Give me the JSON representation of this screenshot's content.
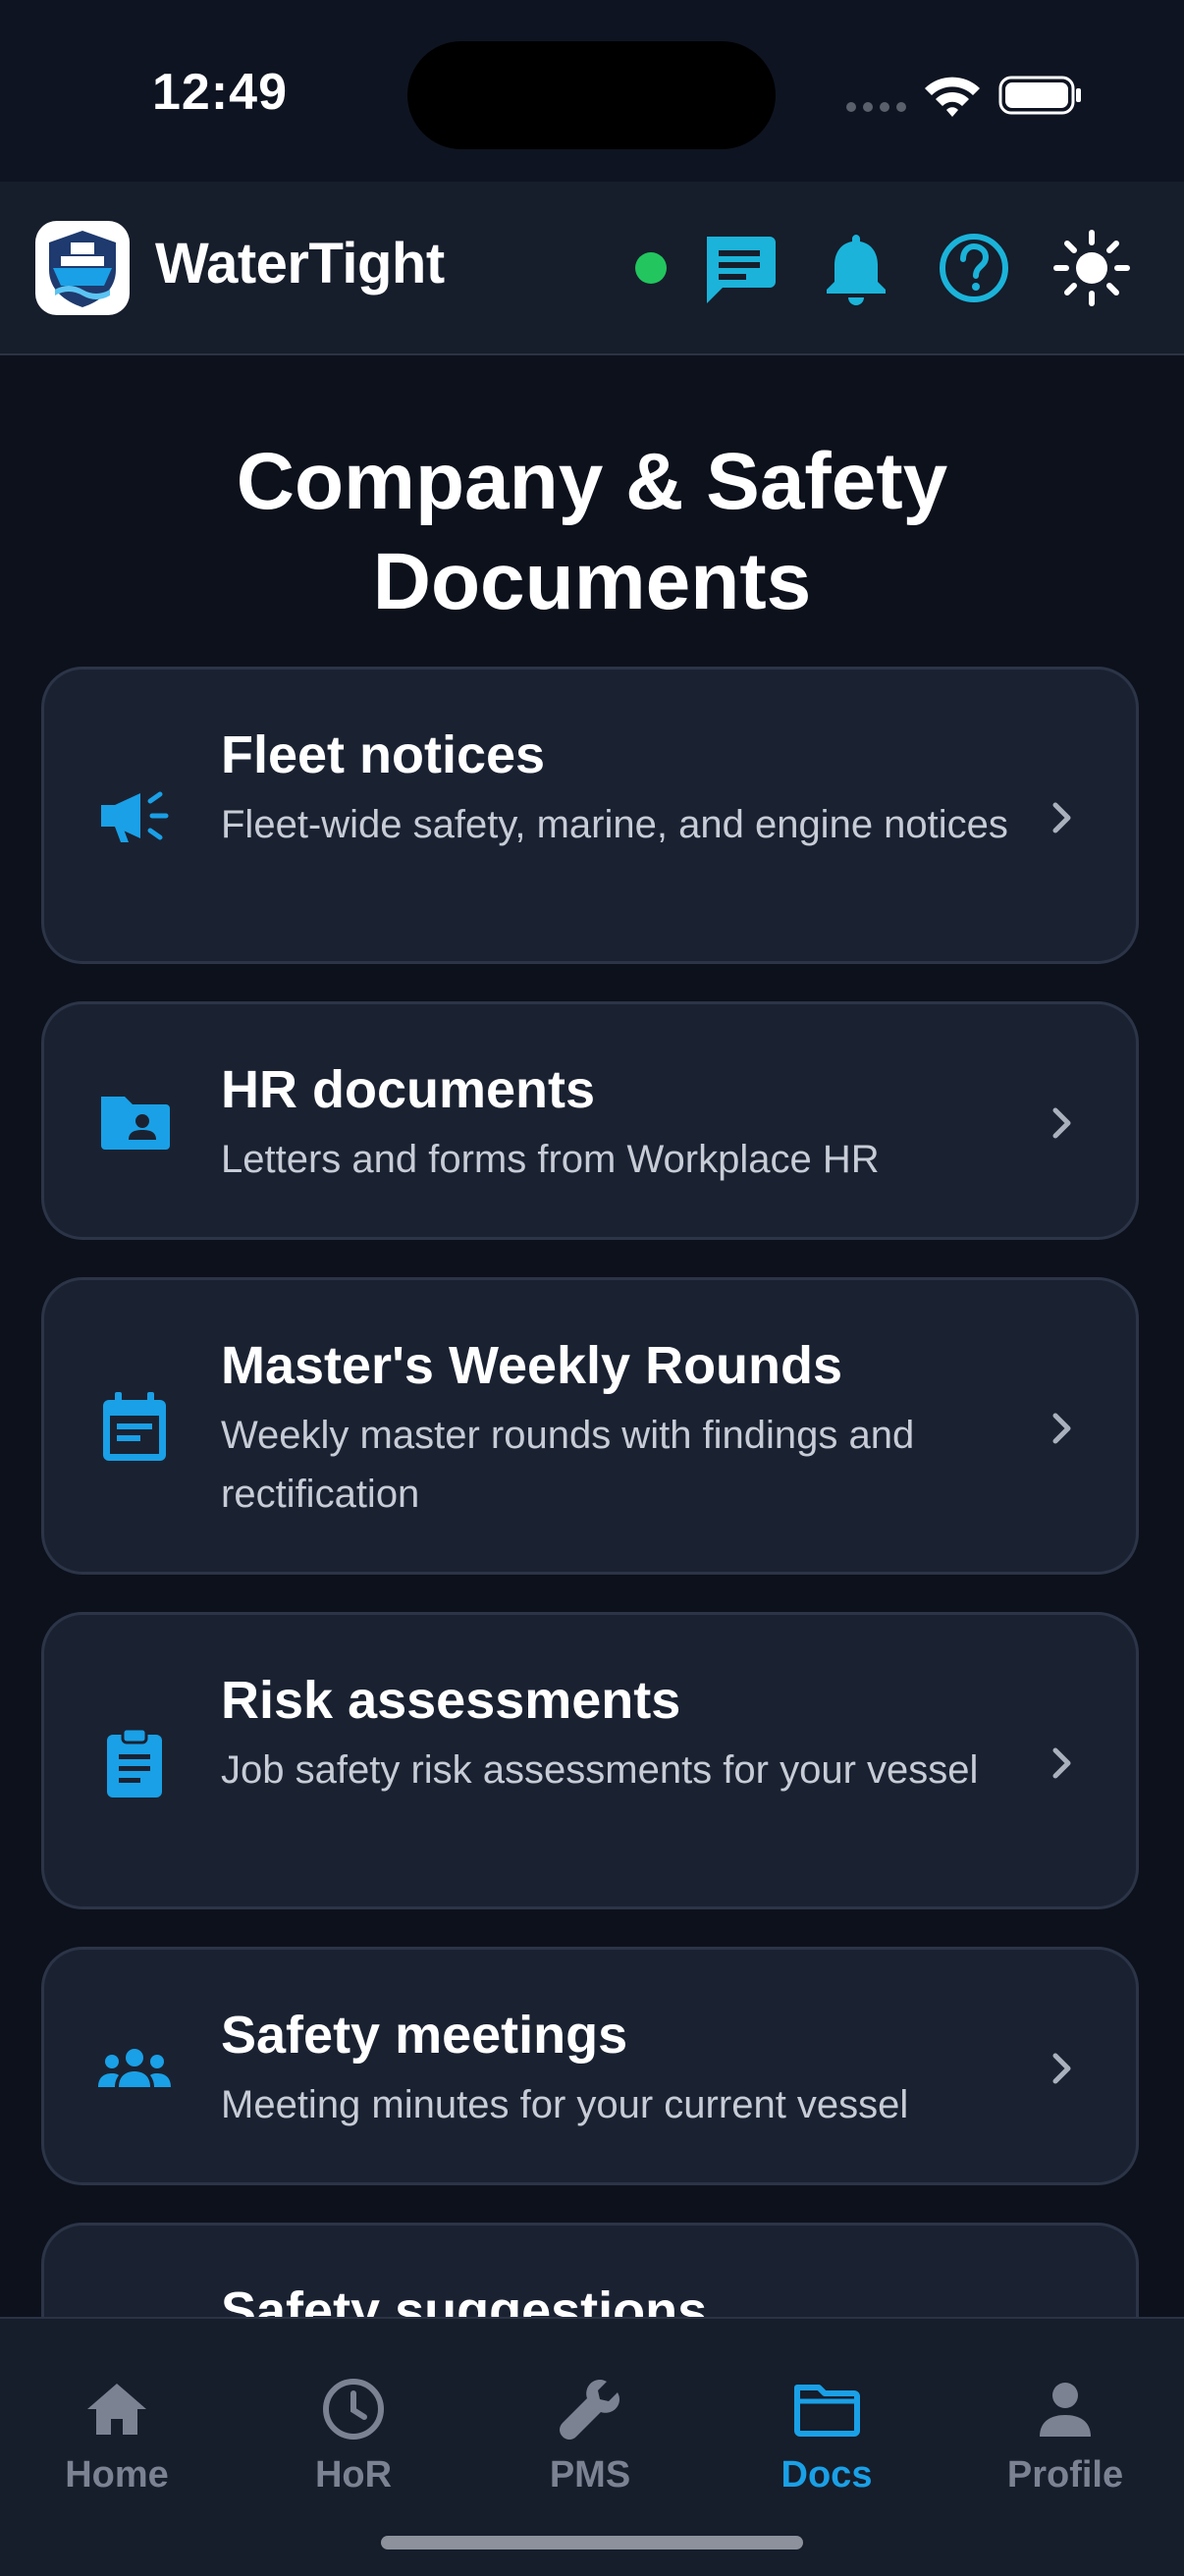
{
  "status_bar": {
    "time": "12:49"
  },
  "header": {
    "app_name": "WaterTight",
    "icons": [
      "ship-logo-icon",
      "online-status-dot",
      "chat-icon",
      "bell-icon",
      "help-icon",
      "sun-icon"
    ]
  },
  "page": {
    "title_line1": "Company & Safety",
    "title_line2": "Documents"
  },
  "cards": [
    {
      "title": "Fleet notices",
      "description": "Fleet-wide safety, marine, and engine notices",
      "icon": "megaphone-icon"
    },
    {
      "title": "HR documents",
      "description": "Letters and forms from Workplace HR",
      "icon": "folder-person-icon"
    },
    {
      "title": "Master's Weekly Rounds",
      "description": "Weekly master rounds with findings and rectification",
      "icon": "calendar-icon"
    },
    {
      "title": "Risk assessments",
      "description": "Job safety risk assessments for your vessel",
      "icon": "clipboard-icon"
    },
    {
      "title": "Safety meetings",
      "description": "Meeting minutes for your current vessel",
      "icon": "group-icon"
    },
    {
      "title": "Safety suggestions",
      "description": "",
      "icon": "lightbulb-icon"
    }
  ],
  "nav": {
    "active": "Docs",
    "items": [
      {
        "label": "Home",
        "icon": "home-icon"
      },
      {
        "label": "HoR",
        "icon": "clock-icon"
      },
      {
        "label": "PMS",
        "icon": "wrench-icon"
      },
      {
        "label": "Docs",
        "icon": "folder-icon"
      },
      {
        "label": "Profile",
        "icon": "person-icon"
      }
    ]
  },
  "colors": {
    "background": "#0c111c",
    "surface": "#1a2232",
    "accent": "#1aa0e6",
    "online": "#22c55e",
    "nav_inactive": "#7b8393"
  }
}
